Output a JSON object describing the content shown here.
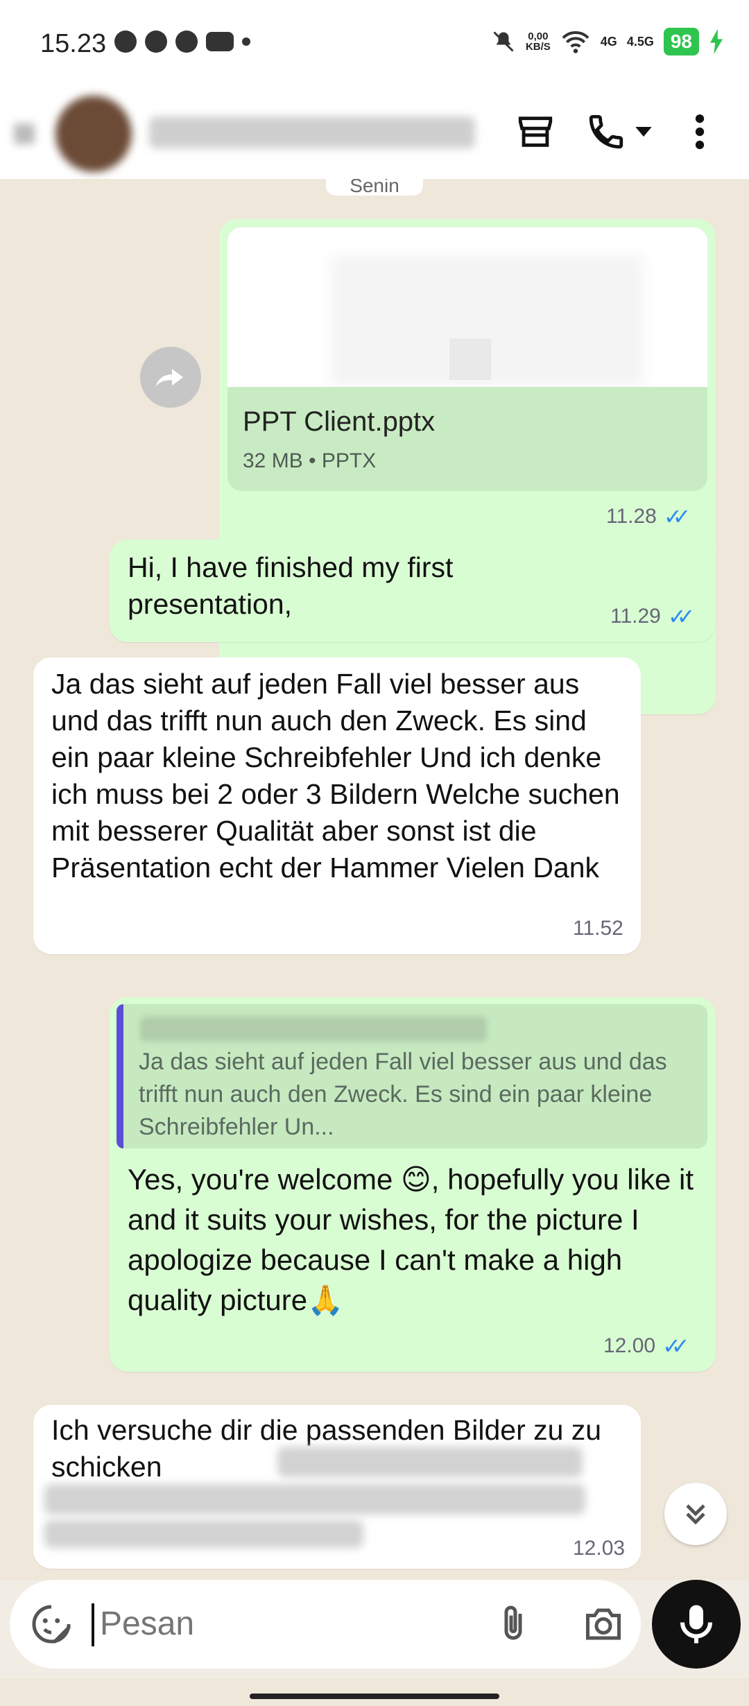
{
  "status_bar": {
    "time": "15.23",
    "net_speed_value": "0,00",
    "net_speed_unit": "KB/S",
    "network_1": "4G",
    "network_2": "4.5G",
    "battery": "98"
  },
  "header": {
    "contact_name": "Contact name (blurred)"
  },
  "chat": {
    "date_chip": "Senin",
    "messages": [
      {
        "type": "document",
        "direction": "outgoing",
        "file_name": "PPT Client.pptx",
        "file_meta": "32 MB • PPTX",
        "time": "11.28",
        "status": "read"
      },
      {
        "type": "text",
        "direction": "outgoing",
        "text": "Hi, I have finished my first presentation,",
        "time": "11.29",
        "status": "read"
      },
      {
        "type": "text",
        "direction": "incoming",
        "text": "Ja das sieht auf jeden Fall viel besser aus und das trifft nun auch den Zweck. Es sind ein paar kleine Schreibfehler Und ich denke ich muss bei 2 oder 3 Bildern Welche suchen mit besserer Qualität aber sonst ist die Präsentation echt der Hammer Vielen Dank",
        "time": "11.52"
      },
      {
        "type": "reply",
        "direction": "outgoing",
        "quoted_text": "Ja das sieht auf jeden Fall viel besser aus und das trifft nun auch den Zweck. Es sind ein paar kleine Schreibfehler Un...",
        "text": "Yes, you're welcome 😊, hopefully you like it and it suits your wishes, for the picture I apologize because I can't make a high quality picture🙏",
        "time": "12.00",
        "status": "read"
      },
      {
        "type": "text",
        "direction": "incoming",
        "text": "Ich versuche dir die passenden Bilder zu zu schicken",
        "time": "12.03"
      }
    ]
  },
  "composer": {
    "placeholder": "Pesan"
  },
  "colors": {
    "outgoing_bubble": "#d9fdd3",
    "incoming_bubble": "#ffffff",
    "read_ticks": "#2d8cf0",
    "battery": "#2fc44e"
  },
  "icons": {
    "header": [
      "store-icon",
      "phone-icon",
      "dropdown-arrow-icon",
      "more-vert-icon"
    ],
    "composer": [
      "sticker-icon",
      "attach-icon",
      "camera-icon",
      "mic-icon"
    ]
  }
}
